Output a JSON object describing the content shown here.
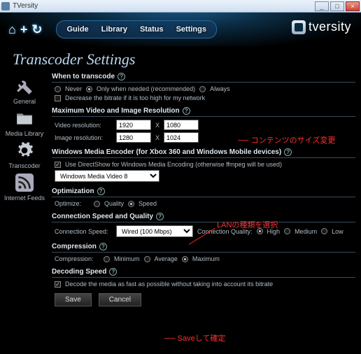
{
  "window": {
    "title": "TVersity",
    "min": "_",
    "max": "□",
    "close": "×"
  },
  "toolbar": {
    "back": "⌂",
    "add": "+",
    "refresh": "↻"
  },
  "nav": {
    "guide": "Guide",
    "library": "Library",
    "status": "Status",
    "settings": "Settings"
  },
  "brand": "tversity",
  "page_title": "Transcoder Settings",
  "sidebar": {
    "general": "General",
    "media": "Media Library",
    "transcoder": "Transcoder",
    "feeds": "Internet Feeds"
  },
  "sections": {
    "when": {
      "title": "When to transcode",
      "never": "Never",
      "needed": "Only when needed (recommended)",
      "always": "Always",
      "decrease": "Decrease the bitrate if it is too high for my network"
    },
    "maxres": {
      "title": "Maximum Video and Image Resolution",
      "video_label": "Video resolution:",
      "video_w": "1920",
      "video_h": "1080",
      "image_label": "Image resolution:",
      "image_w": "1280",
      "image_h": "1024",
      "by": "X"
    },
    "wme": {
      "title": "Windows Media Encoder (for Xbox 360 and Windows Mobile devices)",
      "ds": "Use DirectShow for Windows Media Encoding (otherwise ffmpeg will be used)",
      "codec": "Windows Media Video 8"
    },
    "opt": {
      "title": "Optimization",
      "label": "Optimize:",
      "quality": "Quality",
      "speed": "Speed"
    },
    "conn": {
      "title": "Connection Speed and Quality",
      "speed_label": "Connection Speed:",
      "speed_value": "Wired (100 Mbps)",
      "quality_label": "Connection Quality:",
      "high": "High",
      "medium": "Medium",
      "low": "Low"
    },
    "comp": {
      "title": "Compression",
      "label": "Compression:",
      "min": "Minimum",
      "avg": "Average",
      "max": "Maximum"
    },
    "dec": {
      "title": "Decoding Speed",
      "fast": "Decode the media as fast as possible without taking into account its bitrate"
    }
  },
  "buttons": {
    "save": "Save",
    "cancel": "Cancel"
  },
  "annotations": {
    "size": "コンテンツのサイズ変更",
    "lan": "LANの種類を選択",
    "save": "Saveして確定",
    "dash": "──"
  }
}
